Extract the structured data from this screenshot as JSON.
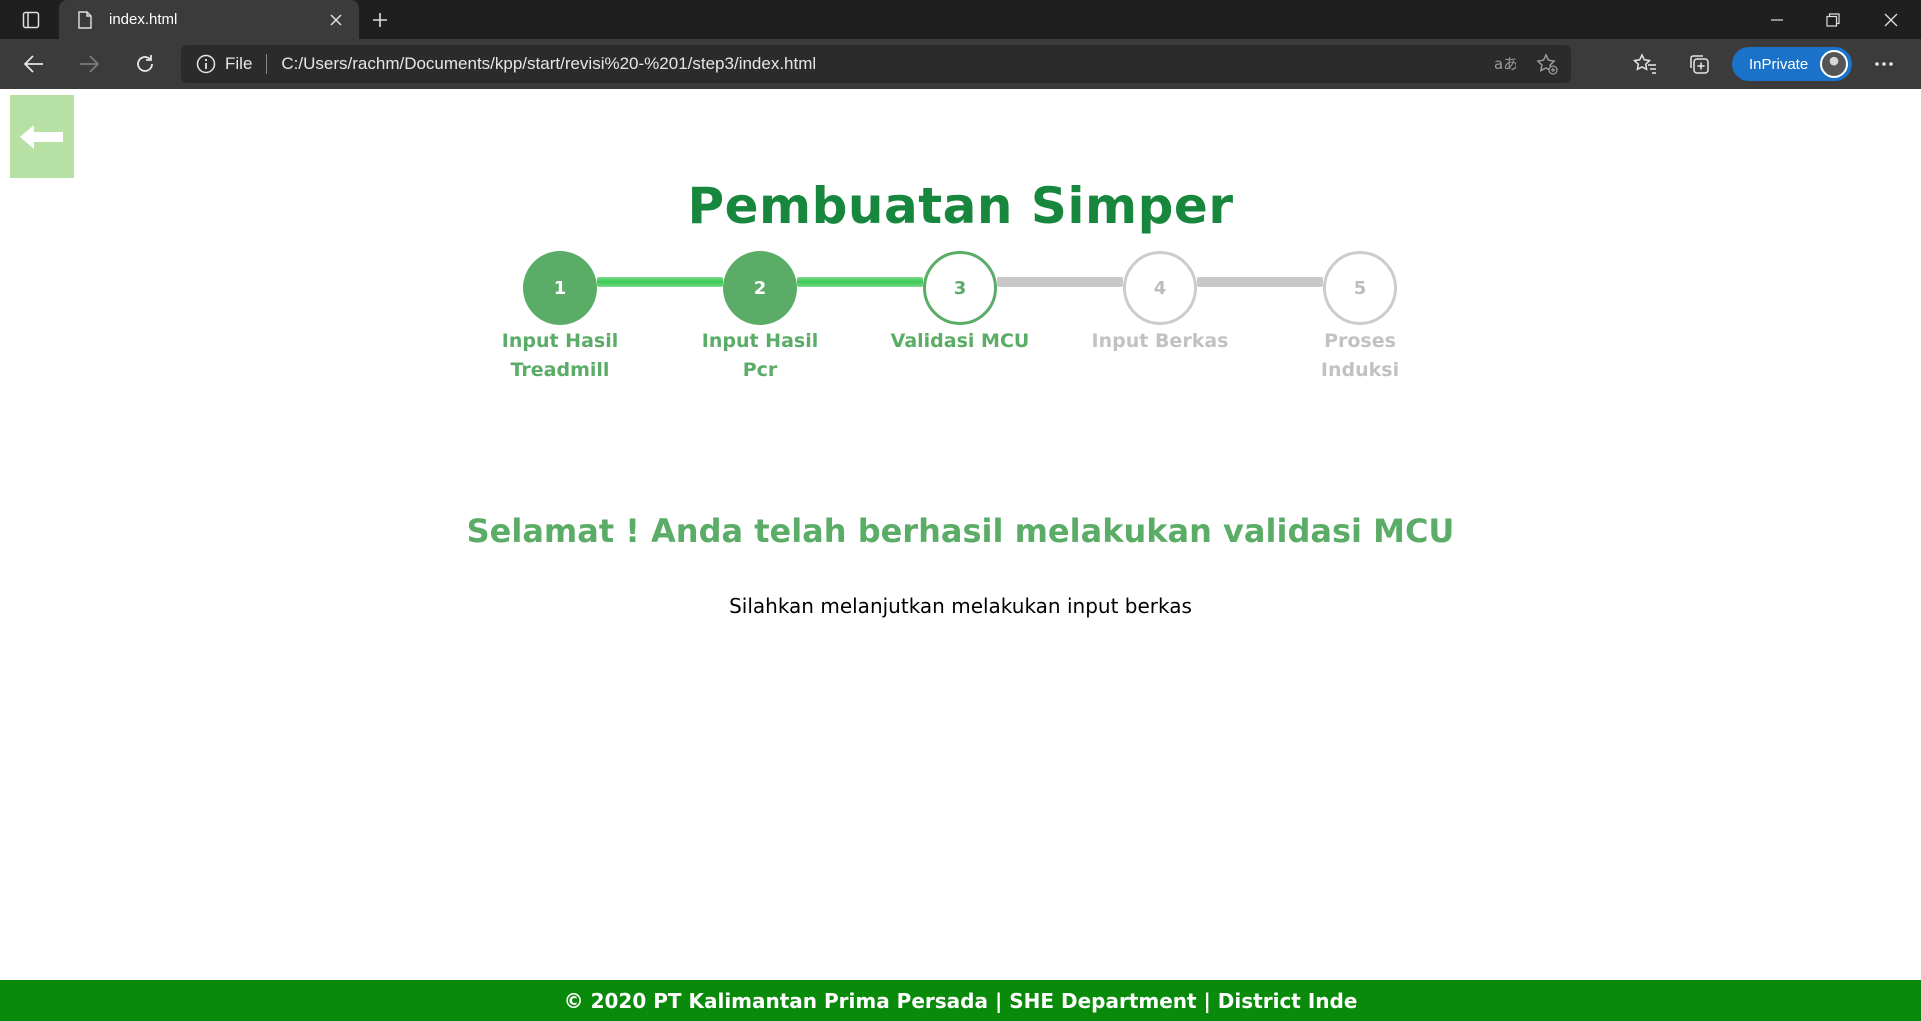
{
  "browser": {
    "tab_title": "index.html",
    "new_tab_symbol": "+",
    "address_scheme": "File",
    "address_url": "C:/Users/rachm/Documents/kpp/start/revisi%20-%201/step3/index.html",
    "inprivate_label": "InPrivate",
    "icons": [
      "tab-actions-icon",
      "document-icon",
      "close-icon",
      "plus-icon",
      "minimize-icon",
      "restore-icon",
      "back-arrow-icon",
      "forward-arrow-icon",
      "refresh-icon",
      "info-icon",
      "read-aloud-icon",
      "add-favorite-icon",
      "favorites-icon",
      "collections-icon",
      "more-icon"
    ]
  },
  "page": {
    "back_icon": "left-arrow-icon",
    "title": "Pembuatan Simper",
    "steps": [
      {
        "number": "1",
        "label": "Input Hasil Treadmill",
        "state": "done"
      },
      {
        "number": "2",
        "label": "Input Hasil Pcr",
        "state": "done"
      },
      {
        "number": "3",
        "label": "Validasi MCU",
        "state": "active"
      },
      {
        "number": "4",
        "label": "Input Berkas",
        "state": "todo"
      },
      {
        "number": "5",
        "label": "Proses Induksi",
        "state": "todo"
      }
    ],
    "success_message": "Selamat ! Anda telah berhasil melakukan validasi MCU",
    "instruction": "Silahkan melanjutkan melakukan input berkas",
    "footer": "© 2020 PT Kalimantan Prima Persada | SHE Department | District Inde"
  },
  "colors": {
    "title_green": "#17873e",
    "step_green": "#5aac66",
    "footer_green": "#0a8a0a",
    "back_button_bg": "#b7e0a5",
    "inactive_gray": "#c8c8c8"
  }
}
